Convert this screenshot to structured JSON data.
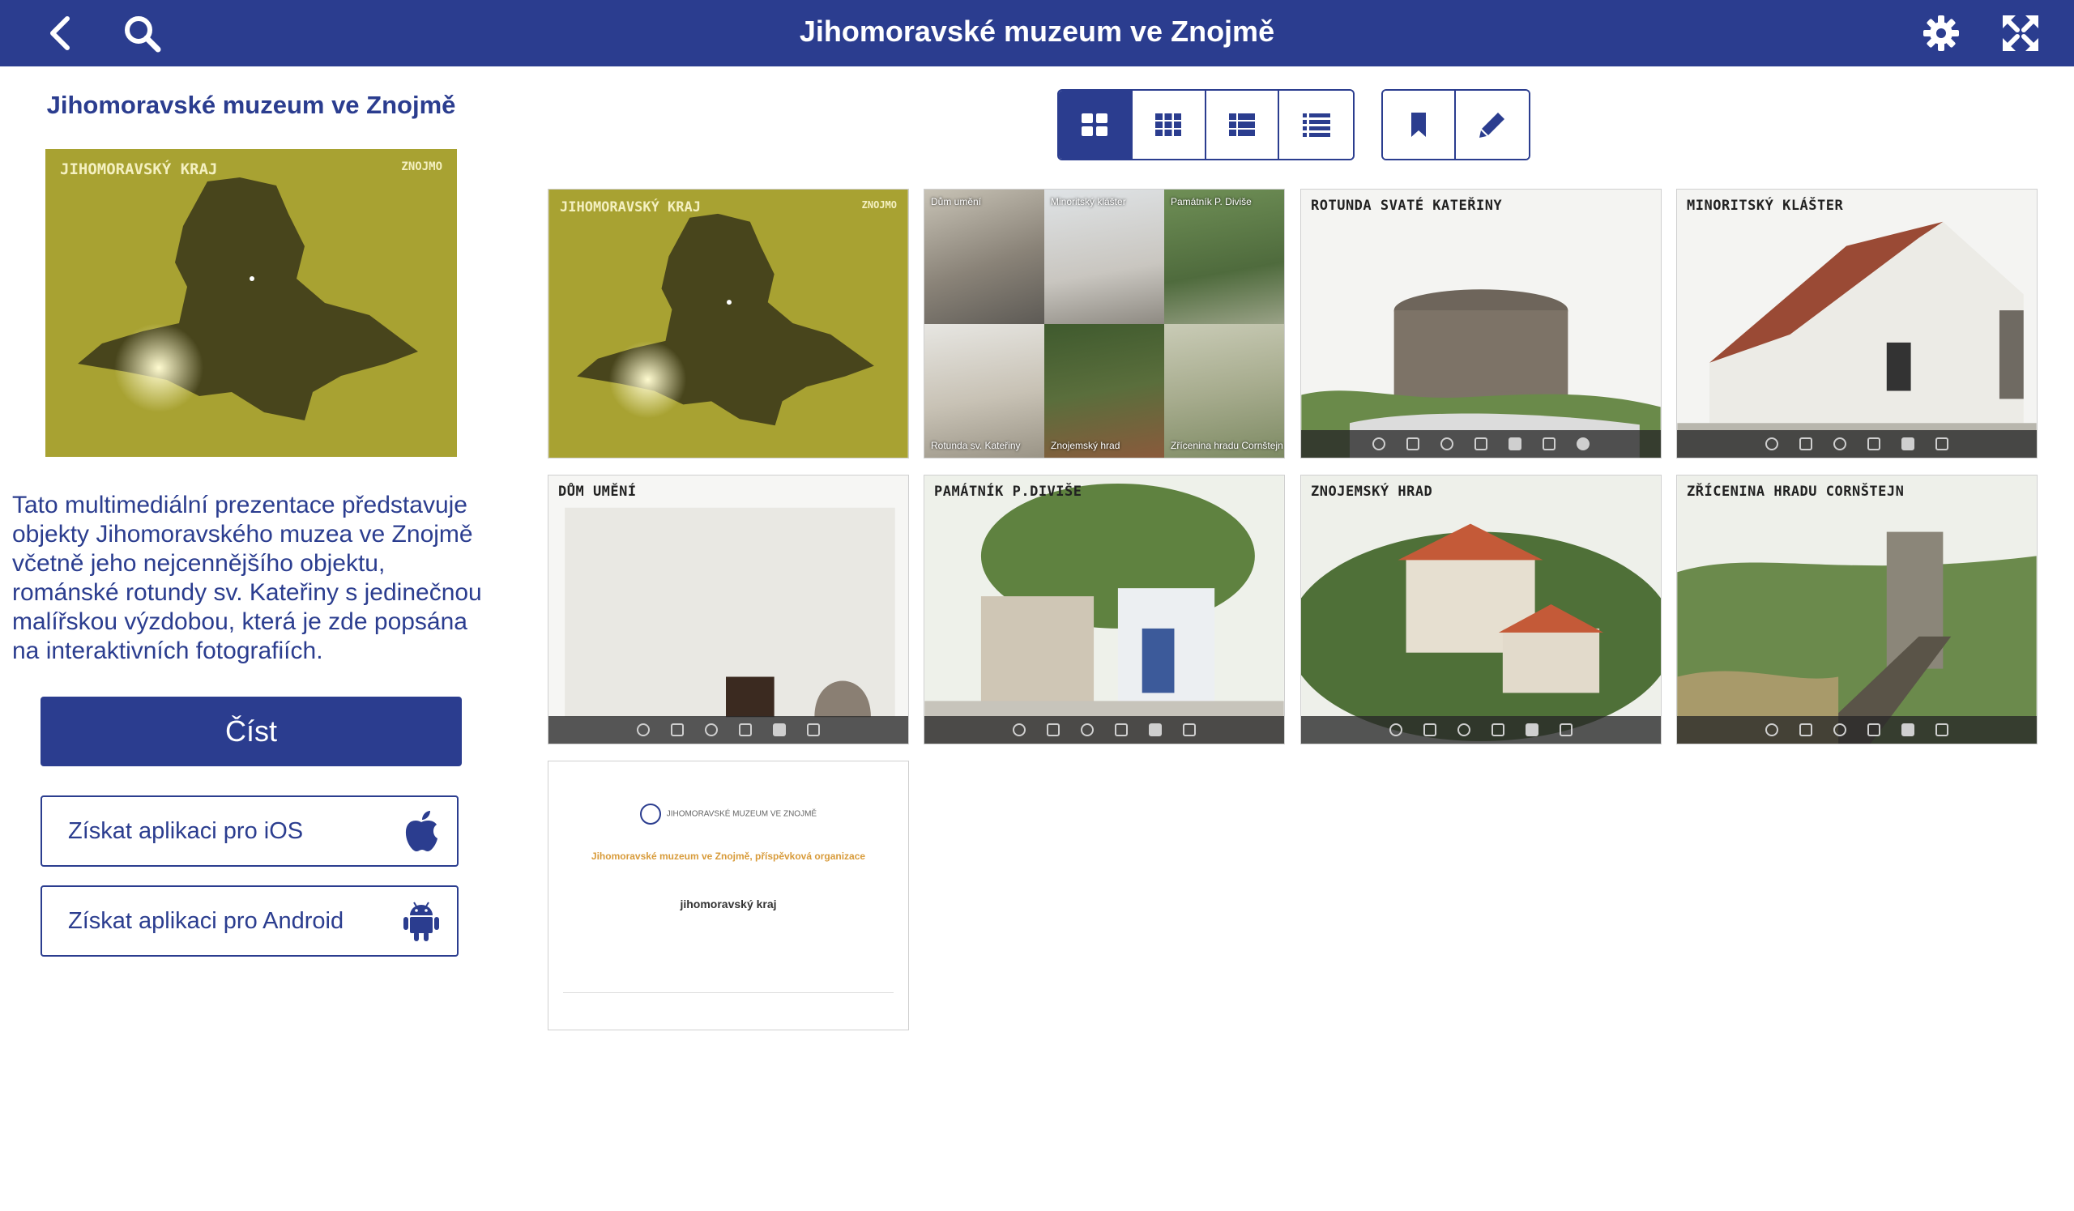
{
  "header": {
    "title": "Jihomoravské muzeum ve Znojmě"
  },
  "sidebar": {
    "title": "Jihomoravské muzeum ve Znojmě",
    "map_region": "JIHOMORAVSKÝ KRAJ",
    "map_city": "ZNOJMO",
    "description": "Tato multimediální prezentace představuje objekty Jihomoravského muzea ve Znojmě včetně jeho nejcennějšího objektu, románské rotundy sv. Kateřiny s jedinečnou malířskou výzdobou, která je zde popsána na interaktivních fotografiích.",
    "read_label": "Číst",
    "ios_label": "Získat aplikaci pro iOS",
    "android_label": "Získat aplikaci pro Android"
  },
  "tiles": {
    "t1": {
      "region": "JIHOMORAVSKÝ KRAJ",
      "city": "ZNOJMO"
    },
    "t2": {
      "cells": [
        "Dům umění",
        "Minoritský klášter",
        "Památník P. Diviše",
        "Rotunda sv. Kateřiny",
        "Znojemský hrad",
        "Zřícenina hradu Cornštejn"
      ]
    },
    "t3": {
      "label": "ROTUNDA SVATÉ KATEŘINY"
    },
    "t4": {
      "label": "MINORITSKÝ KLÁŠTER"
    },
    "t5": {
      "label": "DŮM UMĚNÍ"
    },
    "t6": {
      "label": "PAMÁTNÍK P.DIVIŠE"
    },
    "t7": {
      "label": "ZNOJEMSKÝ HRAD"
    },
    "t8": {
      "label": "ZŘÍCENINA HRADU CORNŠTEJN"
    },
    "t9": {
      "logo_text": "JIHOMORAVSKÉ MUZEUM VE ZNOJMĚ",
      "org": "Jihomoravské muzeum ve Znojmě, příspěvková organizace",
      "region": "jihomoravský kraj"
    }
  },
  "colors": {
    "brand": "#2b3d8f",
    "map_bg": "#a8a232",
    "map_land": "#48451c"
  }
}
